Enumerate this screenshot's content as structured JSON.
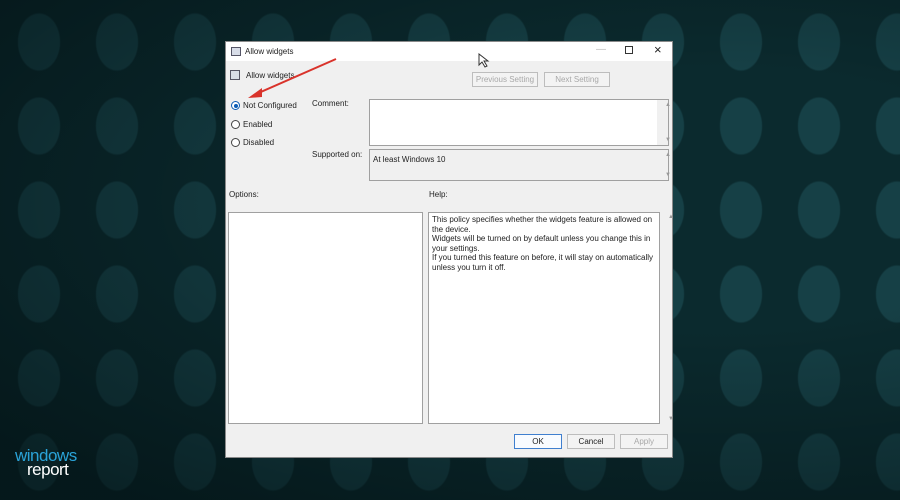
{
  "dialog": {
    "title": "Allow widgets",
    "policy_name": "Allow widgets",
    "prev_label": "Previous Setting",
    "next_label": "Next Setting",
    "radios": [
      {
        "label": "Not Configured",
        "checked": true
      },
      {
        "label": "Enabled",
        "checked": false
      },
      {
        "label": "Disabled",
        "checked": false
      }
    ],
    "comment_label": "Comment:",
    "comment_value": "",
    "supported_label": "Supported on:",
    "supported_value": "At least Windows 10",
    "options_label": "Options:",
    "help_label": "Help:",
    "help_lines": [
      "This policy specifies whether the widgets feature is allowed on the device.",
      "Widgets will be turned on by default unless you change this in your settings.",
      "If you turned this feature on before, it will stay on automatically unless you turn it off."
    ],
    "ok_label": "OK",
    "cancel_label": "Cancel",
    "apply_label": "Apply"
  },
  "watermark": {
    "line1": "windows",
    "line2": "report"
  },
  "colors": {
    "accent": "#0d5db5",
    "arrow": "#d9332b"
  }
}
